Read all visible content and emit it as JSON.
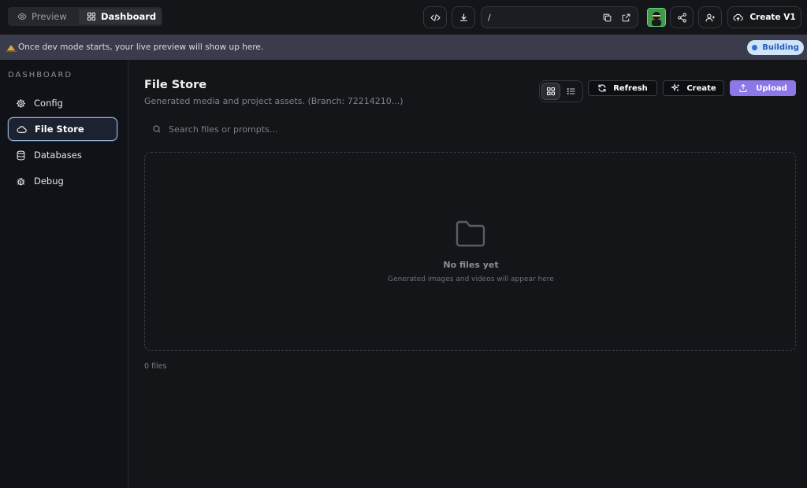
{
  "topbar": {
    "tabs": [
      {
        "label": "Preview",
        "icon": "eye-icon"
      },
      {
        "label": "Dashboard",
        "icon": "grid-icon"
      }
    ],
    "url": {
      "value": "/"
    },
    "create_label": "Create V1"
  },
  "notice": {
    "text": "Once dev mode starts, your live preview will show up here.",
    "status_badge": "Building"
  },
  "sidebar": {
    "title": "DASHBOARD",
    "items": [
      {
        "label": "Config",
        "icon": "gear-icon"
      },
      {
        "label": "File Store",
        "icon": "cloud-icon",
        "active": true
      },
      {
        "label": "Databases",
        "icon": "database-icon"
      },
      {
        "label": "Debug",
        "icon": "bug-icon"
      }
    ]
  },
  "main": {
    "title": "File Store",
    "subtitle": "Generated media and project assets. (Branch: 72214210...)",
    "actions": {
      "refresh": "Refresh",
      "create": "Create",
      "upload": "Upload"
    },
    "search": {
      "placeholder": "Search files or prompts...",
      "value": ""
    },
    "empty": {
      "title": "No files yet",
      "subtitle": "Generated images and videos will appear here"
    },
    "file_count": "0 files"
  },
  "colors": {
    "background": "#141519",
    "sidebar": "#111217",
    "notice_bar": "#3a3c4b",
    "accent_upload": "#8e77e6",
    "status_badge_bg": "#cfe3fb",
    "status_badge_text": "#1f5fb8"
  }
}
